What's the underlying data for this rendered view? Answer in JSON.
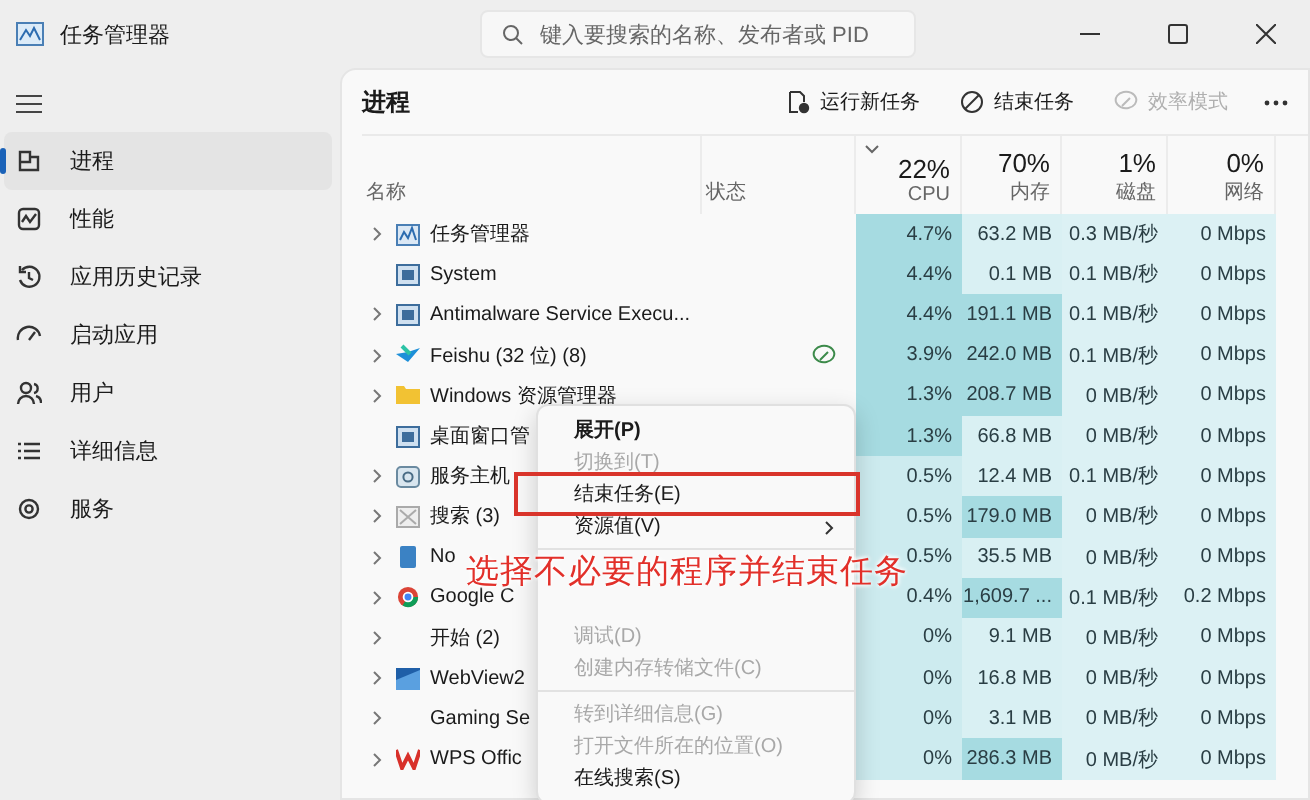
{
  "window": {
    "title": "任务管理器"
  },
  "search": {
    "placeholder": "键入要搜索的名称、发布者或 PID"
  },
  "sidebar": {
    "items": [
      {
        "label": "进程",
        "selected": true
      },
      {
        "label": "性能",
        "selected": false
      },
      {
        "label": "应用历史记录",
        "selected": false
      },
      {
        "label": "启动应用",
        "selected": false
      },
      {
        "label": "用户",
        "selected": false
      },
      {
        "label": "详细信息",
        "selected": false
      },
      {
        "label": "服务",
        "selected": false
      }
    ]
  },
  "page_title": "进程",
  "toolbar": [
    {
      "label": "运行新任务",
      "disabled": false
    },
    {
      "label": "结束任务",
      "disabled": false
    },
    {
      "label": "效率模式",
      "disabled": true
    }
  ],
  "table": {
    "columns": [
      {
        "kind": "name",
        "label": "名称"
      },
      {
        "kind": "status",
        "label": "状态"
      },
      {
        "kind": "metric",
        "total": "22%",
        "label": "CPU",
        "sorted": true
      },
      {
        "kind": "metric",
        "total": "70%",
        "label": "内存",
        "sorted": false
      },
      {
        "kind": "metric",
        "total": "1%",
        "label": "磁盘",
        "sorted": false
      },
      {
        "kind": "metric",
        "total": "0%",
        "label": "网络",
        "sorted": false
      }
    ],
    "rows": [
      {
        "name": "任务管理器",
        "expandable": true,
        "efficiency": false,
        "cpu": "4.7%",
        "memory": "63.2 MB",
        "disk": "0.3 MB/秒",
        "network": "0 Mbps",
        "cpu_busy": true,
        "memory_busy": false
      },
      {
        "name": "System",
        "expandable": false,
        "efficiency": false,
        "cpu": "4.4%",
        "memory": "0.1 MB",
        "disk": "0.1 MB/秒",
        "network": "0 Mbps",
        "cpu_busy": true,
        "memory_busy": false
      },
      {
        "name": "Antimalware Service Execu...",
        "expandable": true,
        "efficiency": false,
        "cpu": "4.4%",
        "memory": "191.1 MB",
        "disk": "0.1 MB/秒",
        "network": "0 Mbps",
        "cpu_busy": true,
        "memory_busy": true
      },
      {
        "name": "Feishu (32 位) (8)",
        "expandable": true,
        "efficiency": true,
        "cpu": "3.9%",
        "memory": "242.0 MB",
        "disk": "0.1 MB/秒",
        "network": "0 Mbps",
        "cpu_busy": true,
        "memory_busy": true
      },
      {
        "name": "Windows 资源管理器",
        "expandable": true,
        "efficiency": false,
        "cpu": "1.3%",
        "memory": "208.7 MB",
        "disk": "0 MB/秒",
        "network": "0 Mbps",
        "cpu_busy": true,
        "memory_busy": true
      },
      {
        "name": "桌面窗口管",
        "expandable": false,
        "efficiency": false,
        "cpu": "1.3%",
        "memory": "66.8 MB",
        "disk": "0 MB/秒",
        "network": "0 Mbps",
        "cpu_busy": true,
        "memory_busy": false
      },
      {
        "name": "服务主机",
        "expandable": true,
        "efficiency": false,
        "cpu": "0.5%",
        "memory": "12.4 MB",
        "disk": "0.1 MB/秒",
        "network": "0 Mbps",
        "cpu_busy": false,
        "memory_busy": false
      },
      {
        "name": "搜索 (3)",
        "expandable": true,
        "efficiency": false,
        "cpu": "0.5%",
        "memory": "179.0 MB",
        "disk": "0 MB/秒",
        "network": "0 Mbps",
        "cpu_busy": false,
        "memory_busy": true
      },
      {
        "name": "No",
        "expandable": true,
        "efficiency": false,
        "cpu": "0.5%",
        "memory": "35.5 MB",
        "disk": "0 MB/秒",
        "network": "0 Mbps",
        "cpu_busy": false,
        "memory_busy": false
      },
      {
        "name": "Google C",
        "expandable": true,
        "efficiency": false,
        "cpu": "0.4%",
        "memory": "1,609.7 ...",
        "disk": "0.1 MB/秒",
        "network": "0.2 Mbps",
        "cpu_busy": false,
        "memory_busy": true
      },
      {
        "name": "开始 (2)",
        "expandable": true,
        "efficiency": false,
        "cpu": "0%",
        "memory": "9.1 MB",
        "disk": "0 MB/秒",
        "network": "0 Mbps",
        "cpu_busy": false,
        "memory_busy": false
      },
      {
        "name": "WebView2",
        "expandable": true,
        "efficiency": false,
        "cpu": "0%",
        "memory": "16.8 MB",
        "disk": "0 MB/秒",
        "network": "0 Mbps",
        "cpu_busy": false,
        "memory_busy": false
      },
      {
        "name": "Gaming Se",
        "expandable": true,
        "efficiency": false,
        "cpu": "0%",
        "memory": "3.1 MB",
        "disk": "0 MB/秒",
        "network": "0 Mbps",
        "cpu_busy": false,
        "memory_busy": false
      },
      {
        "name": "WPS Offic",
        "expandable": true,
        "efficiency": false,
        "cpu": "0%",
        "memory": "286.3 MB",
        "disk": "0 MB/秒",
        "network": "0 Mbps",
        "cpu_busy": false,
        "memory_busy": true
      }
    ]
  },
  "context_menu": {
    "items": [
      {
        "kind": "item",
        "label": "展开(P)",
        "disabled": false,
        "bold": true,
        "submenu": false,
        "framed": false
      },
      {
        "kind": "item",
        "label": "切换到(T)",
        "disabled": true,
        "bold": false,
        "submenu": false,
        "framed": false
      },
      {
        "kind": "item",
        "label": "结束任务(E)",
        "disabled": false,
        "bold": false,
        "submenu": false,
        "framed": true
      },
      {
        "kind": "item",
        "label": "资源值(V)",
        "disabled": false,
        "bold": false,
        "submenu": true,
        "framed": false
      },
      {
        "kind": "separator"
      },
      {
        "kind": "blank"
      },
      {
        "kind": "blank"
      },
      {
        "kind": "item",
        "label": "调试(D)",
        "disabled": true,
        "bold": false,
        "submenu": false,
        "framed": false
      },
      {
        "kind": "item",
        "label": "创建内存转储文件(C)",
        "disabled": true,
        "bold": false,
        "submenu": false,
        "framed": false
      },
      {
        "kind": "separator"
      },
      {
        "kind": "item",
        "label": "转到详细信息(G)",
        "disabled": true,
        "bold": false,
        "submenu": false,
        "framed": false
      },
      {
        "kind": "item",
        "label": "打开文件所在的位置(O)",
        "disabled": true,
        "bold": false,
        "submenu": false,
        "framed": false
      },
      {
        "kind": "item",
        "label": "在线搜索(S)",
        "disabled": false,
        "bold": false,
        "submenu": false,
        "framed": false
      }
    ]
  },
  "annotation": {
    "text": "选择不必要的程序并结束任务"
  }
}
